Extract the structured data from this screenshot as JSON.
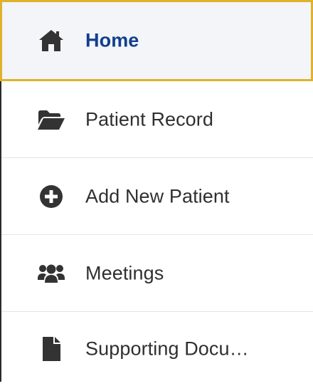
{
  "nav": {
    "items": [
      {
        "label": "Home",
        "icon": "home-icon",
        "active": true
      },
      {
        "label": "Patient Record",
        "icon": "folder-open-icon",
        "active": false
      },
      {
        "label": "Add New Patient",
        "icon": "plus-circle-icon",
        "active": false
      },
      {
        "label": "Meetings",
        "icon": "users-icon",
        "active": false
      },
      {
        "label": "Supporting Docu…",
        "icon": "file-icon",
        "active": false
      }
    ]
  },
  "colors": {
    "active_text": "#123f8c",
    "active_border": "#e0b22b",
    "active_background": "#f3f5f9",
    "icon": "#333333",
    "text": "#2f2f2f"
  }
}
